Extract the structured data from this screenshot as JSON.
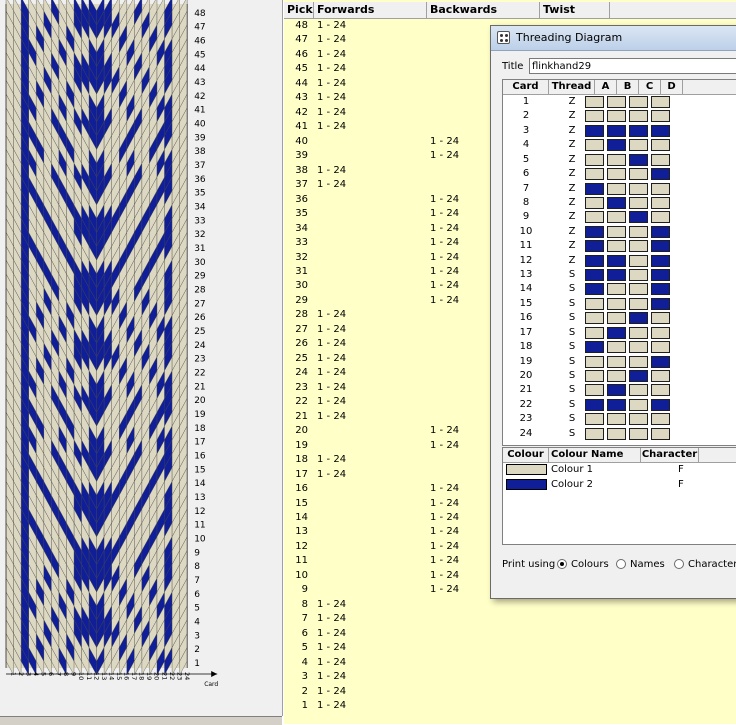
{
  "pattern": {
    "colours": {
      "light": "#ddd8c2",
      "dark": "#101f98",
      "grid": "#444444"
    },
    "pick_labels": [
      "48",
      "47",
      "46",
      "45",
      "44",
      "43",
      "42",
      "41",
      "40",
      "39",
      "38",
      "37",
      "36",
      "35",
      "34",
      "33",
      "32",
      "31",
      "30",
      "29",
      "28",
      "27",
      "26",
      "25",
      "24",
      "23",
      "22",
      "21",
      "20",
      "19",
      "18",
      "17",
      "16",
      "15",
      "14",
      "13",
      "12",
      "11",
      "10",
      "9",
      "8",
      "7",
      "6",
      "5",
      "4",
      "3",
      "2",
      "1"
    ],
    "card_axis_label": "Card"
  },
  "pick_table": {
    "headers": {
      "pick": "Pick",
      "forwards": "Forwards",
      "backwards": "Backwards",
      "twist": "Twist"
    },
    "rows": [
      {
        "pick": "48",
        "fwd": "1 - 24",
        "bwd": ""
      },
      {
        "pick": "47",
        "fwd": "1 - 24",
        "bwd": ""
      },
      {
        "pick": "46",
        "fwd": "1 - 24",
        "bwd": ""
      },
      {
        "pick": "45",
        "fwd": "1 - 24",
        "bwd": ""
      },
      {
        "pick": "44",
        "fwd": "1 - 24",
        "bwd": ""
      },
      {
        "pick": "43",
        "fwd": "1 - 24",
        "bwd": ""
      },
      {
        "pick": "42",
        "fwd": "1 - 24",
        "bwd": ""
      },
      {
        "pick": "41",
        "fwd": "1 - 24",
        "bwd": ""
      },
      {
        "pick": "40",
        "fwd": "",
        "bwd": "1 - 24"
      },
      {
        "pick": "39",
        "fwd": "",
        "bwd": "1 - 24"
      },
      {
        "pick": "38",
        "fwd": "1 - 24",
        "bwd": ""
      },
      {
        "pick": "37",
        "fwd": "1 - 24",
        "bwd": ""
      },
      {
        "pick": "36",
        "fwd": "",
        "bwd": "1 - 24"
      },
      {
        "pick": "35",
        "fwd": "",
        "bwd": "1 - 24"
      },
      {
        "pick": "34",
        "fwd": "",
        "bwd": "1 - 24"
      },
      {
        "pick": "33",
        "fwd": "",
        "bwd": "1 - 24"
      },
      {
        "pick": "32",
        "fwd": "",
        "bwd": "1 - 24"
      },
      {
        "pick": "31",
        "fwd": "",
        "bwd": "1 - 24"
      },
      {
        "pick": "30",
        "fwd": "",
        "bwd": "1 - 24"
      },
      {
        "pick": "29",
        "fwd": "",
        "bwd": "1 - 24"
      },
      {
        "pick": "28",
        "fwd": "1 - 24",
        "bwd": ""
      },
      {
        "pick": "27",
        "fwd": "1 - 24",
        "bwd": ""
      },
      {
        "pick": "26",
        "fwd": "1 - 24",
        "bwd": ""
      },
      {
        "pick": "25",
        "fwd": "1 - 24",
        "bwd": ""
      },
      {
        "pick": "24",
        "fwd": "1 - 24",
        "bwd": ""
      },
      {
        "pick": "23",
        "fwd": "1 - 24",
        "bwd": ""
      },
      {
        "pick": "22",
        "fwd": "1 - 24",
        "bwd": ""
      },
      {
        "pick": "21",
        "fwd": "1 - 24",
        "bwd": ""
      },
      {
        "pick": "20",
        "fwd": "",
        "bwd": "1 - 24"
      },
      {
        "pick": "19",
        "fwd": "",
        "bwd": "1 - 24"
      },
      {
        "pick": "18",
        "fwd": "1 - 24",
        "bwd": ""
      },
      {
        "pick": "17",
        "fwd": "1 - 24",
        "bwd": ""
      },
      {
        "pick": "16",
        "fwd": "",
        "bwd": "1 - 24"
      },
      {
        "pick": "15",
        "fwd": "",
        "bwd": "1 - 24"
      },
      {
        "pick": "14",
        "fwd": "",
        "bwd": "1 - 24"
      },
      {
        "pick": "13",
        "fwd": "",
        "bwd": "1 - 24"
      },
      {
        "pick": "12",
        "fwd": "",
        "bwd": "1 - 24"
      },
      {
        "pick": "11",
        "fwd": "",
        "bwd": "1 - 24"
      },
      {
        "pick": "10",
        "fwd": "",
        "bwd": "1 - 24"
      },
      {
        "pick": "9",
        "fwd": "",
        "bwd": "1 - 24"
      },
      {
        "pick": "8",
        "fwd": "1 - 24",
        "bwd": ""
      },
      {
        "pick": "7",
        "fwd": "1 - 24",
        "bwd": ""
      },
      {
        "pick": "6",
        "fwd": "1 - 24",
        "bwd": ""
      },
      {
        "pick": "5",
        "fwd": "1 - 24",
        "bwd": ""
      },
      {
        "pick": "4",
        "fwd": "1 - 24",
        "bwd": ""
      },
      {
        "pick": "3",
        "fwd": "1 - 24",
        "bwd": ""
      },
      {
        "pick": "2",
        "fwd": "1 - 24",
        "bwd": ""
      },
      {
        "pick": "1",
        "fwd": "1 - 24",
        "bwd": ""
      }
    ]
  },
  "dialog": {
    "title": "Threading Diagram",
    "title_label": "Title",
    "title_value": "flinkhand29",
    "card_headers": {
      "card": "Card",
      "thread": "Thread",
      "a": "A",
      "b": "B",
      "c": "C",
      "d": "D"
    },
    "cards": [
      {
        "card": "1",
        "thread": "Z",
        "holes": [
          1,
          1,
          1,
          1
        ]
      },
      {
        "card": "2",
        "thread": "Z",
        "holes": [
          1,
          1,
          1,
          1
        ]
      },
      {
        "card": "3",
        "thread": "Z",
        "holes": [
          2,
          2,
          2,
          2
        ]
      },
      {
        "card": "4",
        "thread": "Z",
        "holes": [
          1,
          2,
          1,
          1
        ]
      },
      {
        "card": "5",
        "thread": "Z",
        "holes": [
          1,
          1,
          2,
          1
        ]
      },
      {
        "card": "6",
        "thread": "Z",
        "holes": [
          1,
          1,
          1,
          2
        ]
      },
      {
        "card": "7",
        "thread": "Z",
        "holes": [
          2,
          1,
          1,
          1
        ]
      },
      {
        "card": "8",
        "thread": "Z",
        "holes": [
          1,
          2,
          1,
          1
        ]
      },
      {
        "card": "9",
        "thread": "Z",
        "holes": [
          1,
          1,
          2,
          1
        ]
      },
      {
        "card": "10",
        "thread": "Z",
        "holes": [
          2,
          1,
          1,
          2
        ]
      },
      {
        "card": "11",
        "thread": "Z",
        "holes": [
          2,
          1,
          1,
          2
        ]
      },
      {
        "card": "12",
        "thread": "Z",
        "holes": [
          2,
          2,
          1,
          2
        ]
      },
      {
        "card": "13",
        "thread": "S",
        "holes": [
          2,
          2,
          1,
          2
        ]
      },
      {
        "card": "14",
        "thread": "S",
        "holes": [
          2,
          1,
          1,
          2
        ]
      },
      {
        "card": "15",
        "thread": "S",
        "holes": [
          1,
          1,
          1,
          2
        ]
      },
      {
        "card": "16",
        "thread": "S",
        "holes": [
          1,
          1,
          2,
          1
        ]
      },
      {
        "card": "17",
        "thread": "S",
        "holes": [
          1,
          2,
          1,
          1
        ]
      },
      {
        "card": "18",
        "thread": "S",
        "holes": [
          2,
          1,
          1,
          1
        ]
      },
      {
        "card": "19",
        "thread": "S",
        "holes": [
          1,
          1,
          1,
          2
        ]
      },
      {
        "card": "20",
        "thread": "S",
        "holes": [
          1,
          1,
          2,
          1
        ]
      },
      {
        "card": "21",
        "thread": "S",
        "holes": [
          1,
          2,
          1,
          1
        ]
      },
      {
        "card": "22",
        "thread": "S",
        "holes": [
          2,
          2,
          1,
          2
        ]
      },
      {
        "card": "23",
        "thread": "S",
        "holes": [
          1,
          1,
          1,
          1
        ]
      },
      {
        "card": "24",
        "thread": "S",
        "holes": [
          1,
          1,
          1,
          1
        ]
      }
    ],
    "colour_headers": {
      "colour": "Colour",
      "name": "Colour Name",
      "character": "Character"
    },
    "colours": [
      {
        "swatch": "#ddd8c2",
        "name": "Colour 1",
        "character": "F"
      },
      {
        "swatch": "#101f98",
        "name": "Colour 2",
        "character": "F"
      }
    ],
    "print_label": "Print using",
    "print_options": [
      "Colours",
      "Names",
      "Characters"
    ],
    "print_selected": "Colours"
  }
}
